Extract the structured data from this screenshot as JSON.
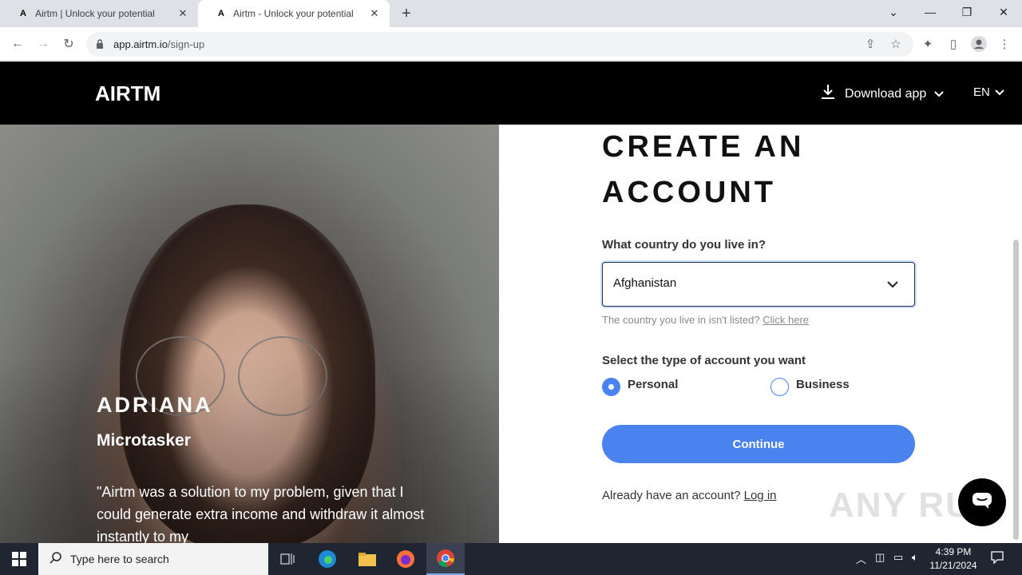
{
  "browser": {
    "tabs": [
      {
        "title": "Airtm | Unlock your potential",
        "active": false
      },
      {
        "title": "Airtm - Unlock your potential",
        "active": true
      }
    ],
    "url_host": "app.airtm.io",
    "url_path": "/sign-up"
  },
  "site": {
    "logo": "AIRTM",
    "download_label": "Download app",
    "language": "EN"
  },
  "testimonial": {
    "name": "ADRIANA",
    "role": "Microtasker",
    "quote": "\"Airtm was a solution to my problem, given that I could generate extra income and withdraw it almost instantly to my"
  },
  "form": {
    "title": "CREATE AN ACCOUNT",
    "country_label": "What country do you live in?",
    "country_value": "Afghanistan",
    "not_listed_text": "The country you live in isn't listed?",
    "not_listed_link": "Click here",
    "type_label": "Select the type of account you want",
    "options": [
      {
        "label": "Personal",
        "selected": true
      },
      {
        "label": "Business",
        "selected": false
      }
    ],
    "continue_label": "Continue",
    "have_account_text": "Already have an account?",
    "login_link": "Log in"
  },
  "watermark": "ANY RUN",
  "taskbar": {
    "search_placeholder": "Type here to search",
    "time": "4:39 PM",
    "date": "11/21/2024"
  },
  "colors": {
    "accent": "#4a82f0",
    "header_bg": "#000000",
    "taskbar_bg": "#1f2632"
  }
}
